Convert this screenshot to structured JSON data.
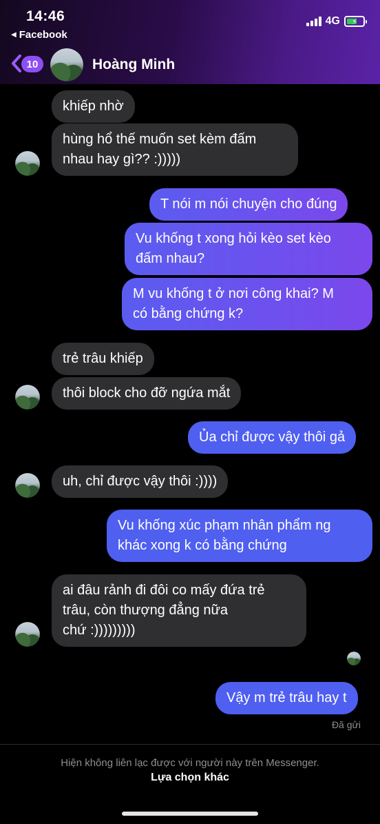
{
  "status_bar": {
    "time": "14:46",
    "back_app": "Facebook",
    "network": "4G",
    "battery_charging": true
  },
  "header": {
    "unread_count": "10",
    "contact_name": "Hoàng Minh"
  },
  "messages": [
    {
      "from": "them",
      "text_lines": [
        "khiếp nhờ"
      ]
    },
    {
      "from": "them",
      "text_lines": [
        "hùng hổ thế muốn set kèm đấm",
        "nhau hay gì?? :)))))"
      ]
    },
    {
      "from": "me",
      "text_lines": [
        "T nói m nói chuyện cho đúng"
      ]
    },
    {
      "from": "me",
      "text_lines": [
        "Vu khống t xong hỏi kèo set kèo",
        "đấm nhau?"
      ]
    },
    {
      "from": "me",
      "text_lines": [
        "M vu khống t ở nơi công khai? M",
        "có bằng chứng k?"
      ]
    },
    {
      "from": "them",
      "text_lines": [
        "trẻ trâu khiếp"
      ]
    },
    {
      "from": "them",
      "text_lines": [
        "thôi block cho đỡ ngứa mắt"
      ]
    },
    {
      "from": "me",
      "text_lines": [
        "Ủa chỉ được vậy thôi gả"
      ]
    },
    {
      "from": "them",
      "text_lines": [
        "uh, chỉ được vậy thôi :))))"
      ]
    },
    {
      "from": "me",
      "text_lines": [
        "Vu khống xúc phạm nhân phẩm ng",
        "khác xong k có bằng chứng"
      ]
    },
    {
      "from": "them",
      "text_lines": [
        "ai đâu rảnh đi đôi co mấy đứa trẻ",
        "trâu, còn thượng đẳng nữa",
        "chứ :)))))))))"
      ]
    },
    {
      "from": "me",
      "text_lines": [
        "Vậy m trẻ trâu hay t"
      ]
    }
  ],
  "sent_status": "Đã gửi",
  "footer": {
    "note": "Hiện không liên lạc được với người này trên Messenger.",
    "action": "Lựa chọn khác"
  },
  "colors": {
    "received_bubble": "#2f2f31",
    "sent_bubble_purple": "#7b48ec",
    "sent_bubble_blue": "#4f5ff0",
    "badge": "#8d4ff4"
  }
}
